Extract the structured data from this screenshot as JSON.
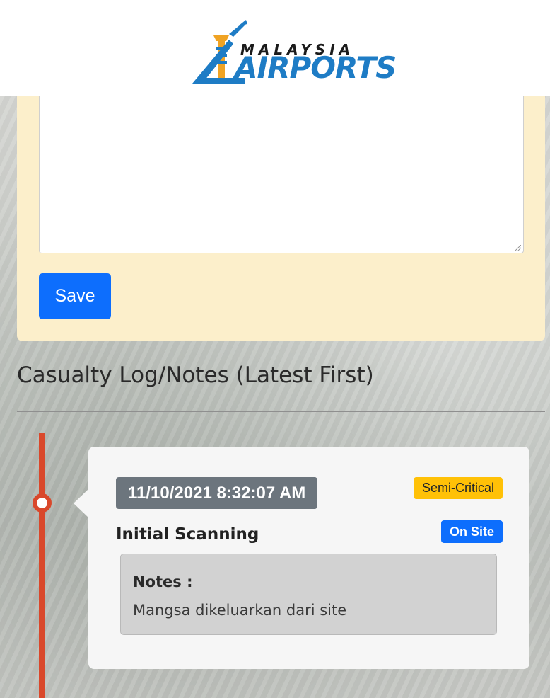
{
  "header": {
    "logo": {
      "line1": "MALAYSIA",
      "line2": "AIRPORTS",
      "brand_blue": "#1e7cc5",
      "brand_orange": "#f0a323"
    }
  },
  "form": {
    "notes_textarea_value": "",
    "save_label": "Save"
  },
  "log": {
    "title": "Casualty Log/Notes (Latest First)",
    "timeline_color": "#d9482b",
    "entries": [
      {
        "timestamp": "11/10/2021 8:32:07 AM",
        "severity": "Semi-Critical",
        "status": "On Site",
        "stage": "Initial Scanning",
        "notes_label": "Notes :",
        "notes_text": "Mangsa dikeluarkan dari site"
      }
    ]
  },
  "colors": {
    "form_bg": "#fcefcb",
    "primary": "#0d6efd",
    "warning": "#ffc107",
    "secondary": "#6c757d"
  }
}
